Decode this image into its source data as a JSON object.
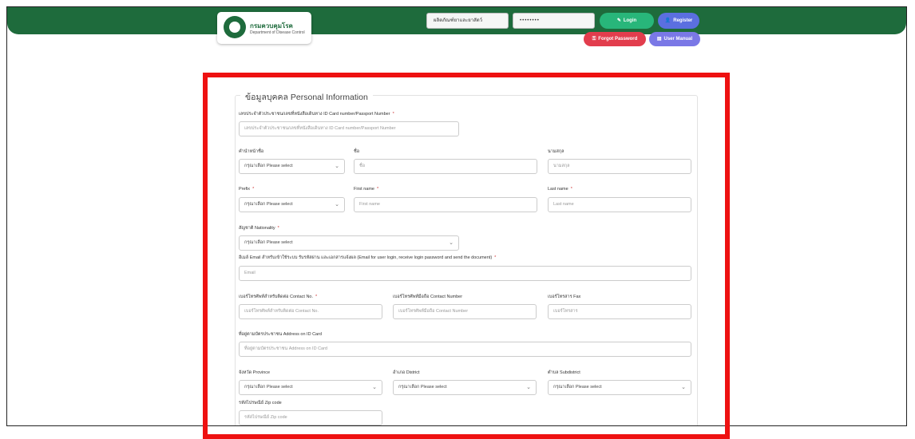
{
  "header": {
    "logo_title": "กรมควบคุมโรค",
    "logo_subtitle": "Department of Disease Control",
    "username_value": "ผลิตภัณฑ์ยาและยาสัตว์",
    "password_value": "••••••••",
    "login_label": "Login",
    "register_label": "Register",
    "forgot_label": "Forgot Password",
    "manual_label": "User Manual"
  },
  "form": {
    "section_title": "ข้อมูลบุคคล Personal Information",
    "id_label": "เลขประจำตัวประชาชน/เลขที่หนังสือเดินทาง ID Card number/Passport Number",
    "id_placeholder": "เลขประจำตัวประชาชน/เลขที่หนังสือเดินทาง ID Card number/Passport Number",
    "title_th_label": "คำนำหน้าชื่อ",
    "title_th_value": "กรุณาเลือก Please select",
    "firstname_th_label": "ชื่อ",
    "firstname_th_placeholder": "ชื่อ",
    "lastname_th_label": "นามสกุล",
    "lastname_th_placeholder": "นามสกุล",
    "prefix_label": "Prefix",
    "prefix_value": "กรุณาเลือก Please select",
    "firstname_en_label": "First name",
    "firstname_en_placeholder": "First name",
    "lastname_en_label": "Last name",
    "lastname_en_placeholder": "Last name",
    "nationality_label": "สัญชาติ Nationality",
    "nationality_value": "กรุณาเลือก Please select",
    "email_label": "อีเมล์ Email สำหรับเข้าใช้ระบบ รับรหัสผ่าน และเอกสารแจ้งผล (Email for user login, receive login password and send the document)",
    "email_placeholder": "Email",
    "phone_label": "เบอร์โทรศัพท์สำหรับติดต่อ Contact No.",
    "phone_placeholder": "เบอร์โทรศัพท์สำหรับติดต่อ Contact No.",
    "mobile_label": "เบอร์โทรศัพท์มือถือ Contact Number",
    "mobile_placeholder": "เบอร์โทรศัพท์มือถือ Contact Number",
    "fax_label": "เบอร์โทรสาร Fax",
    "fax_placeholder": "เบอร์โทรสาร",
    "address_label": "ที่อยู่ตามบัตรประชาชน Address on ID Card",
    "address_placeholder": "ที่อยู่ตามบัตรประชาชน Address on ID Card",
    "province_label": "จังหวัด Province",
    "province_value": "กรุณาเลือก Please select",
    "district_label": "อำเภอ District",
    "district_value": "กรุณาเลือก Please select",
    "subdistrict_label": "ตำบล Subdistrict",
    "subdistrict_value": "กรุณาเลือก Please select",
    "zipcode_label": "รหัสไปรษณีย์ Zip code",
    "zipcode_placeholder": "รหัสไปรษณีย์ Zip code"
  },
  "colors": {
    "header": "#1e6b3c",
    "login": "#28b67a",
    "register": "#5b6fe0",
    "forgot": "#e23d4d",
    "manual": "#7a78e6",
    "highlight": "#ee1111"
  }
}
